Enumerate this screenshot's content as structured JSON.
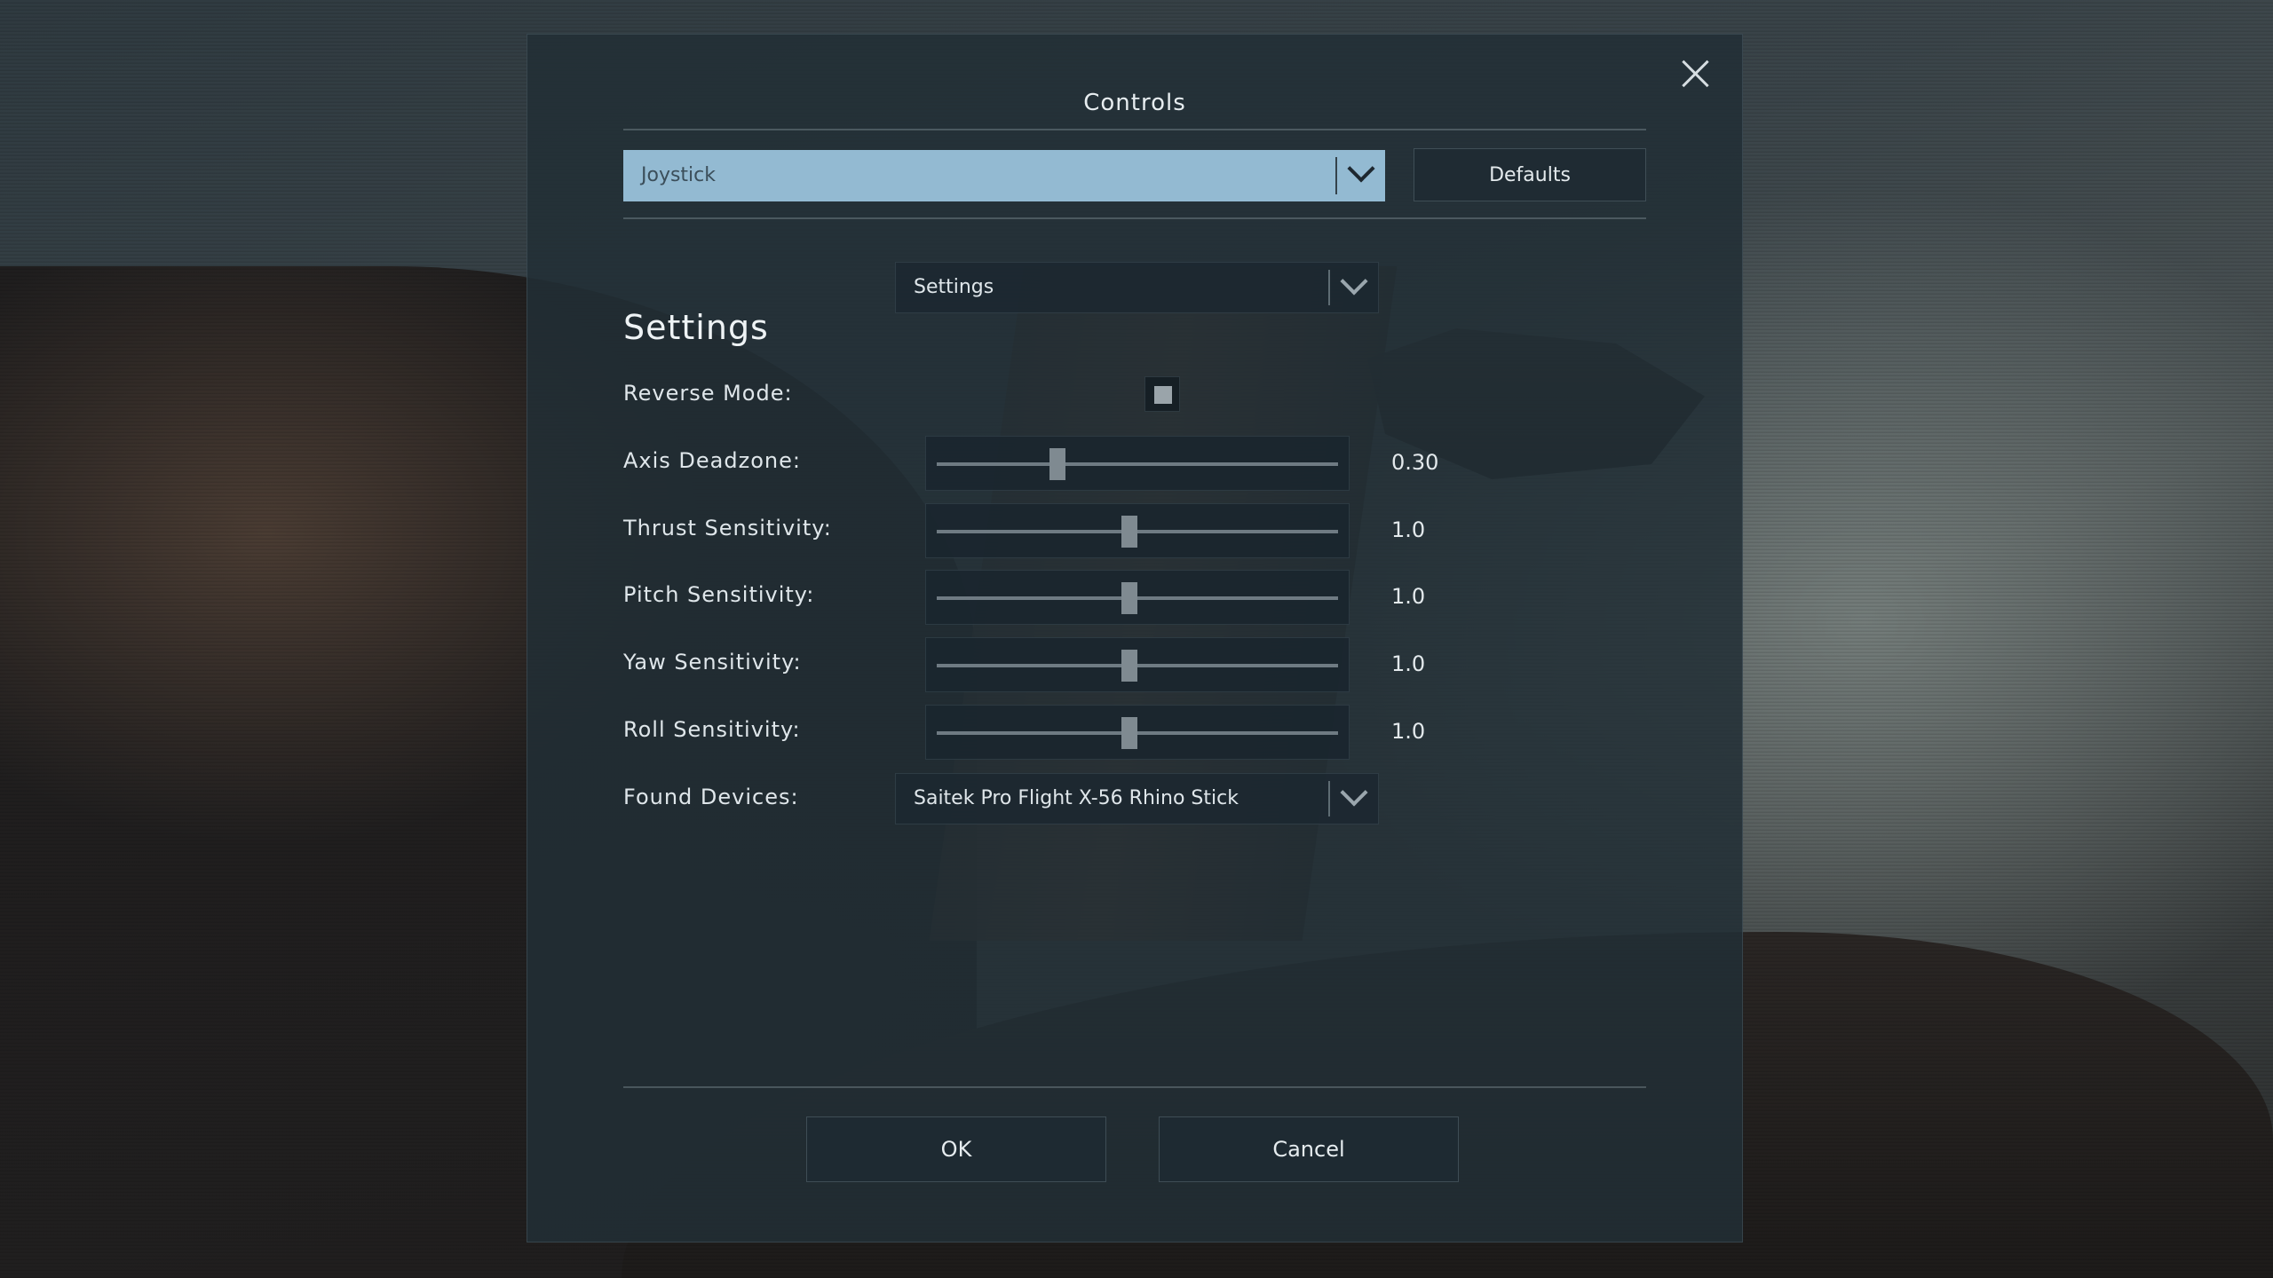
{
  "dialog": {
    "title": "Controls",
    "device_type_select": {
      "value": "Joystick"
    },
    "defaults_label": "Defaults",
    "section_select": {
      "value": "Settings"
    },
    "section_heading": "Settings",
    "reverse_mode": {
      "label": "Reverse Mode:",
      "checked": false
    },
    "sliders": [
      {
        "label": "Axis Deadzone:",
        "value_text": "0.30",
        "fraction": 0.3
      },
      {
        "label": "Thrust Sensitivity:",
        "value_text": "1.0",
        "fraction": 0.48
      },
      {
        "label": "Pitch Sensitivity:",
        "value_text": "1.0",
        "fraction": 0.48
      },
      {
        "label": "Yaw Sensitivity:",
        "value_text": "1.0",
        "fraction": 0.48
      },
      {
        "label": "Roll Sensitivity:",
        "value_text": "1.0",
        "fraction": 0.48
      }
    ],
    "found_devices": {
      "label": "Found Devices:",
      "value": "Saitek Pro Flight X-56 Rhino Stick"
    },
    "ok_label": "OK",
    "cancel_label": "Cancel"
  },
  "icons": {
    "close": "close-icon",
    "dropdown": "chevron-down-icon"
  },
  "colors": {
    "accent_select": "#93bad2",
    "panel": "#222e36"
  }
}
